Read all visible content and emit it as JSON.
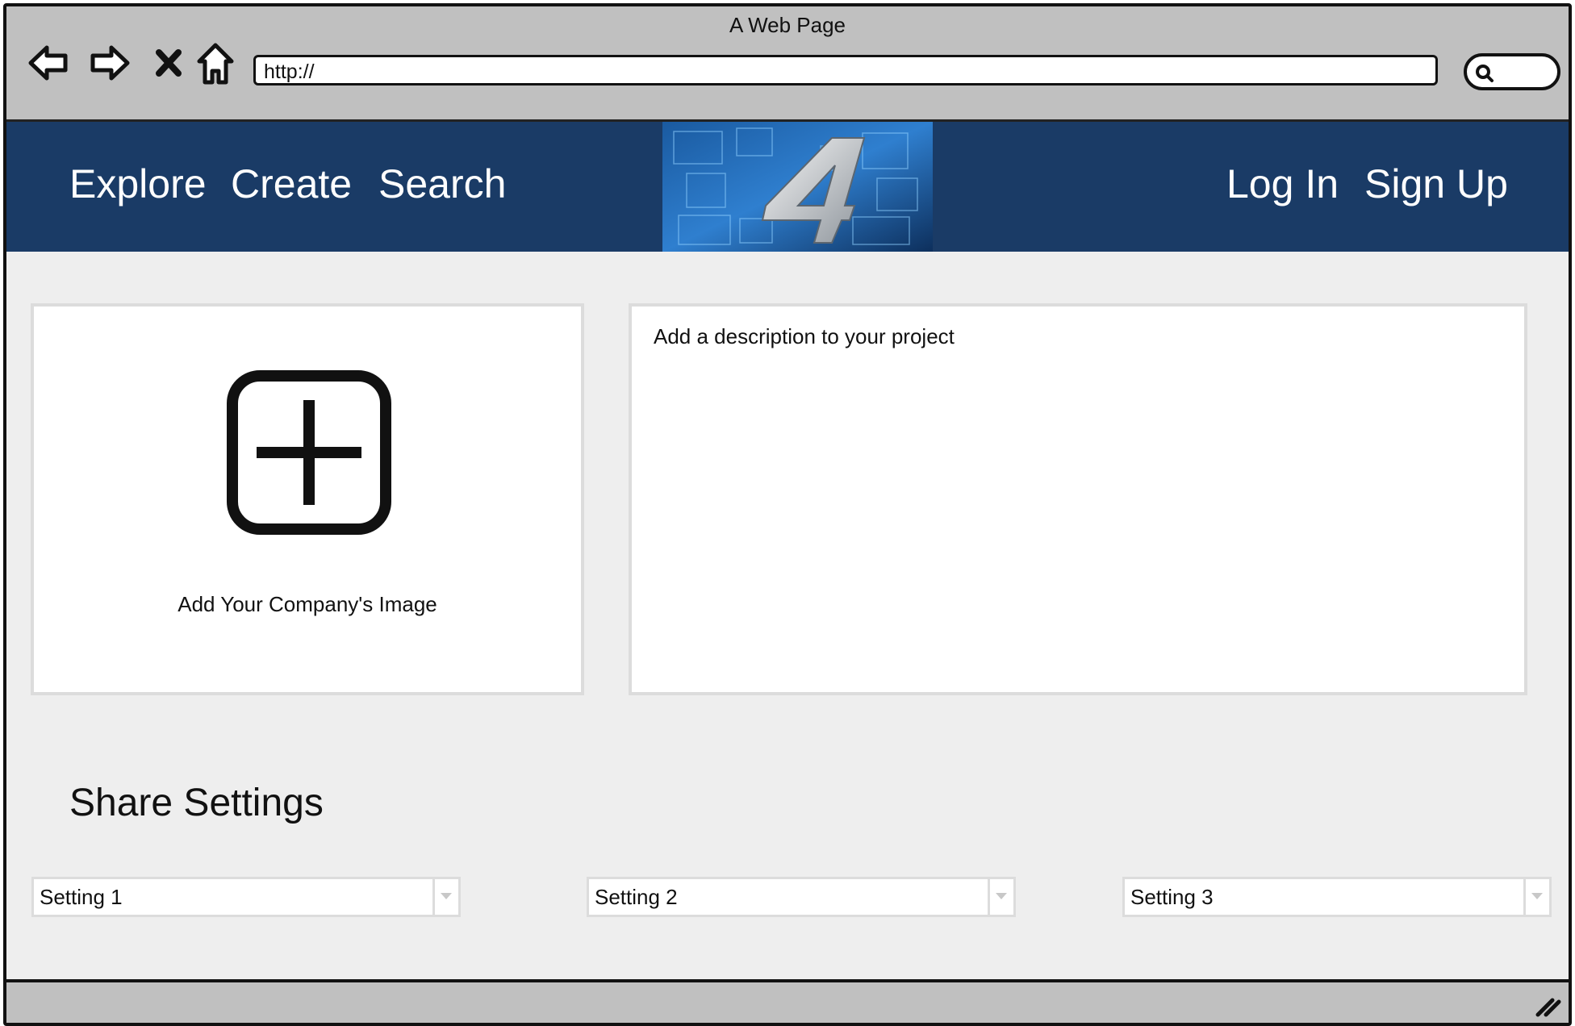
{
  "window": {
    "title": "A Web Page"
  },
  "browser": {
    "nav_icons": [
      "back-arrow-icon",
      "forward-arrow-icon",
      "close-x-icon",
      "home-icon"
    ],
    "url": "http://",
    "search_icon": "search-icon"
  },
  "header": {
    "nav_left": [
      "Explore",
      "Create",
      "Search"
    ],
    "nav_right": [
      "Log In",
      "Sign Up"
    ],
    "logo_icon": "logo-4-icon",
    "background_color": "#1a3b66"
  },
  "main": {
    "image_panel": {
      "icon": "add-plus-square-icon",
      "label": "Add Your Company's Image"
    },
    "description_panel": {
      "placeholder": "Add a description to your project"
    },
    "share_settings": {
      "title": "Share Settings",
      "selects": [
        {
          "value": "Setting 1"
        },
        {
          "value": "Setting 2"
        },
        {
          "value": "Setting 3"
        }
      ]
    }
  },
  "status_bar": {
    "icon": "resize-grip-icon"
  }
}
